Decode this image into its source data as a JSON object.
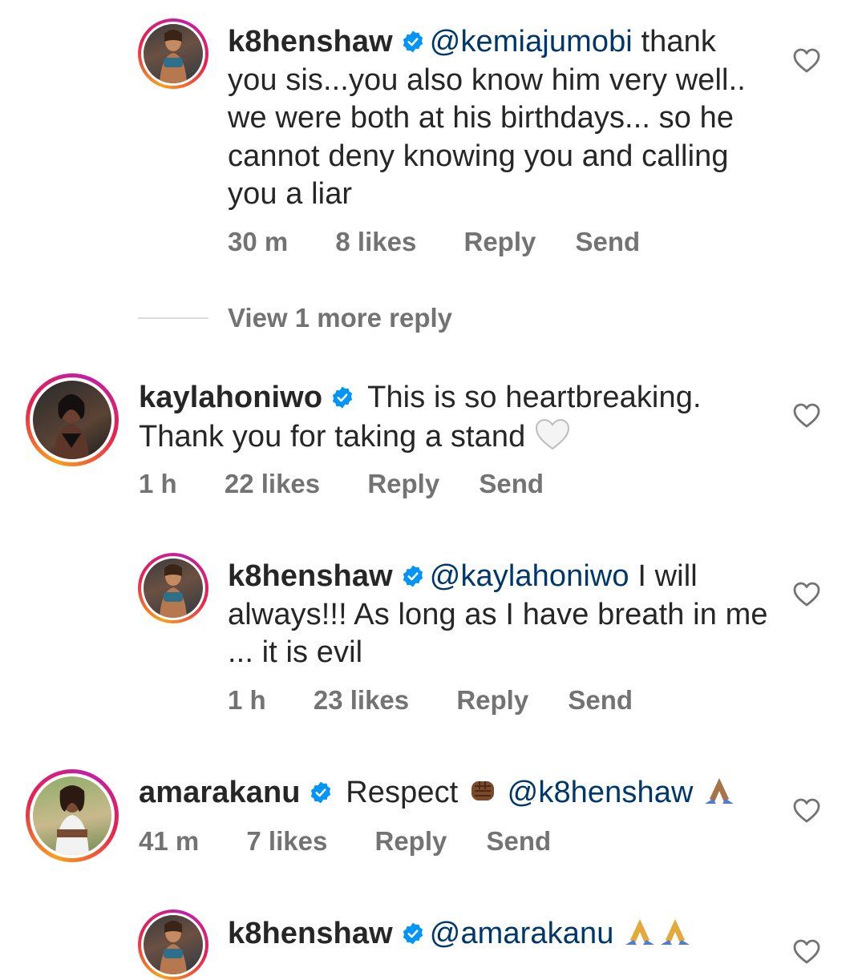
{
  "comments": [
    {
      "username": "k8henshaw",
      "mention": "@kemiajumobi",
      "text": " thank you sis...you also know him very well.. we were both at his birthdays... so he cannot deny knowing you and calling you a liar",
      "time": "30 m",
      "likes": "8 likes",
      "reply": "Reply",
      "send": "Send",
      "avatar": "gym-woman-avatar"
    },
    {
      "username": "kaylahoniwo",
      "text": " This is so heartbreaking. Thank you for taking a stand ",
      "emoji": "white-heart",
      "time": "1 h",
      "likes": "22 likes",
      "reply": "Reply",
      "send": "Send",
      "avatar": "dark-portrait-avatar"
    },
    {
      "username": "k8henshaw",
      "mention": "@kaylahoniwo",
      "text": " I will always!!! As long as I have breath in me ... it is evil",
      "time": "1 h",
      "likes": "23 likes",
      "reply": "Reply",
      "send": "Send",
      "avatar": "gym-woman-avatar"
    },
    {
      "username": "amarakanu",
      "text_before": " Respect ",
      "mention": "@k8henshaw",
      "emoji1": "raised-fist",
      "emoji2": "folded-hands",
      "time": "41 m",
      "likes": "7 likes",
      "reply": "Reply",
      "send": "Send",
      "avatar": "outdoor-portrait-avatar"
    },
    {
      "username": "k8henshaw",
      "mention": "@amarakanu",
      "emoji": "folded-hands-x2",
      "avatar": "gym-woman-avatar"
    }
  ],
  "view_more_replies": "View 1 more reply",
  "colors": {
    "text": "#262626",
    "meta": "#737373",
    "mention": "#00376b",
    "verified": "#0095f6",
    "ring_start": "#f9a11b",
    "ring_end": "#c21fa5"
  }
}
